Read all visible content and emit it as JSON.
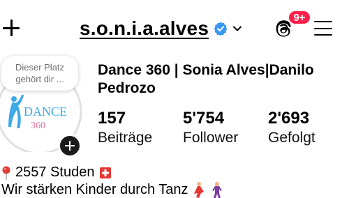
{
  "header": {
    "username": "s.o.n.i.a.alves",
    "notification_count": "9+",
    "icons": {
      "create": "plus-icon",
      "verified": "verified-badge-icon",
      "switch_account": "chevron-down-icon",
      "threads": "threads-icon",
      "menu": "hamburger-menu-icon"
    },
    "colors": {
      "verified": "#3897f0",
      "badge": "#ff1f4b"
    }
  },
  "avatar": {
    "note_text_line1": "Dieser Platz",
    "note_text_line2": "gehört dir ...",
    "logo_text": "DANCE",
    "logo_subtext": "360"
  },
  "profile": {
    "display_name": "Dance 360 | Sonia Alves|Danilo Pedrozo"
  },
  "stats": [
    {
      "value": "157",
      "label": "Beiträge"
    },
    {
      "value": "5'754",
      "label": "Follower"
    },
    {
      "value": "2'693",
      "label": "Gefolgt"
    }
  ],
  "bio": {
    "location_text": "2557 Studen",
    "location_icon": "pin-icon",
    "flag": "swiss-flag",
    "line2": "Wir stärken Kinder durch Tanz"
  }
}
